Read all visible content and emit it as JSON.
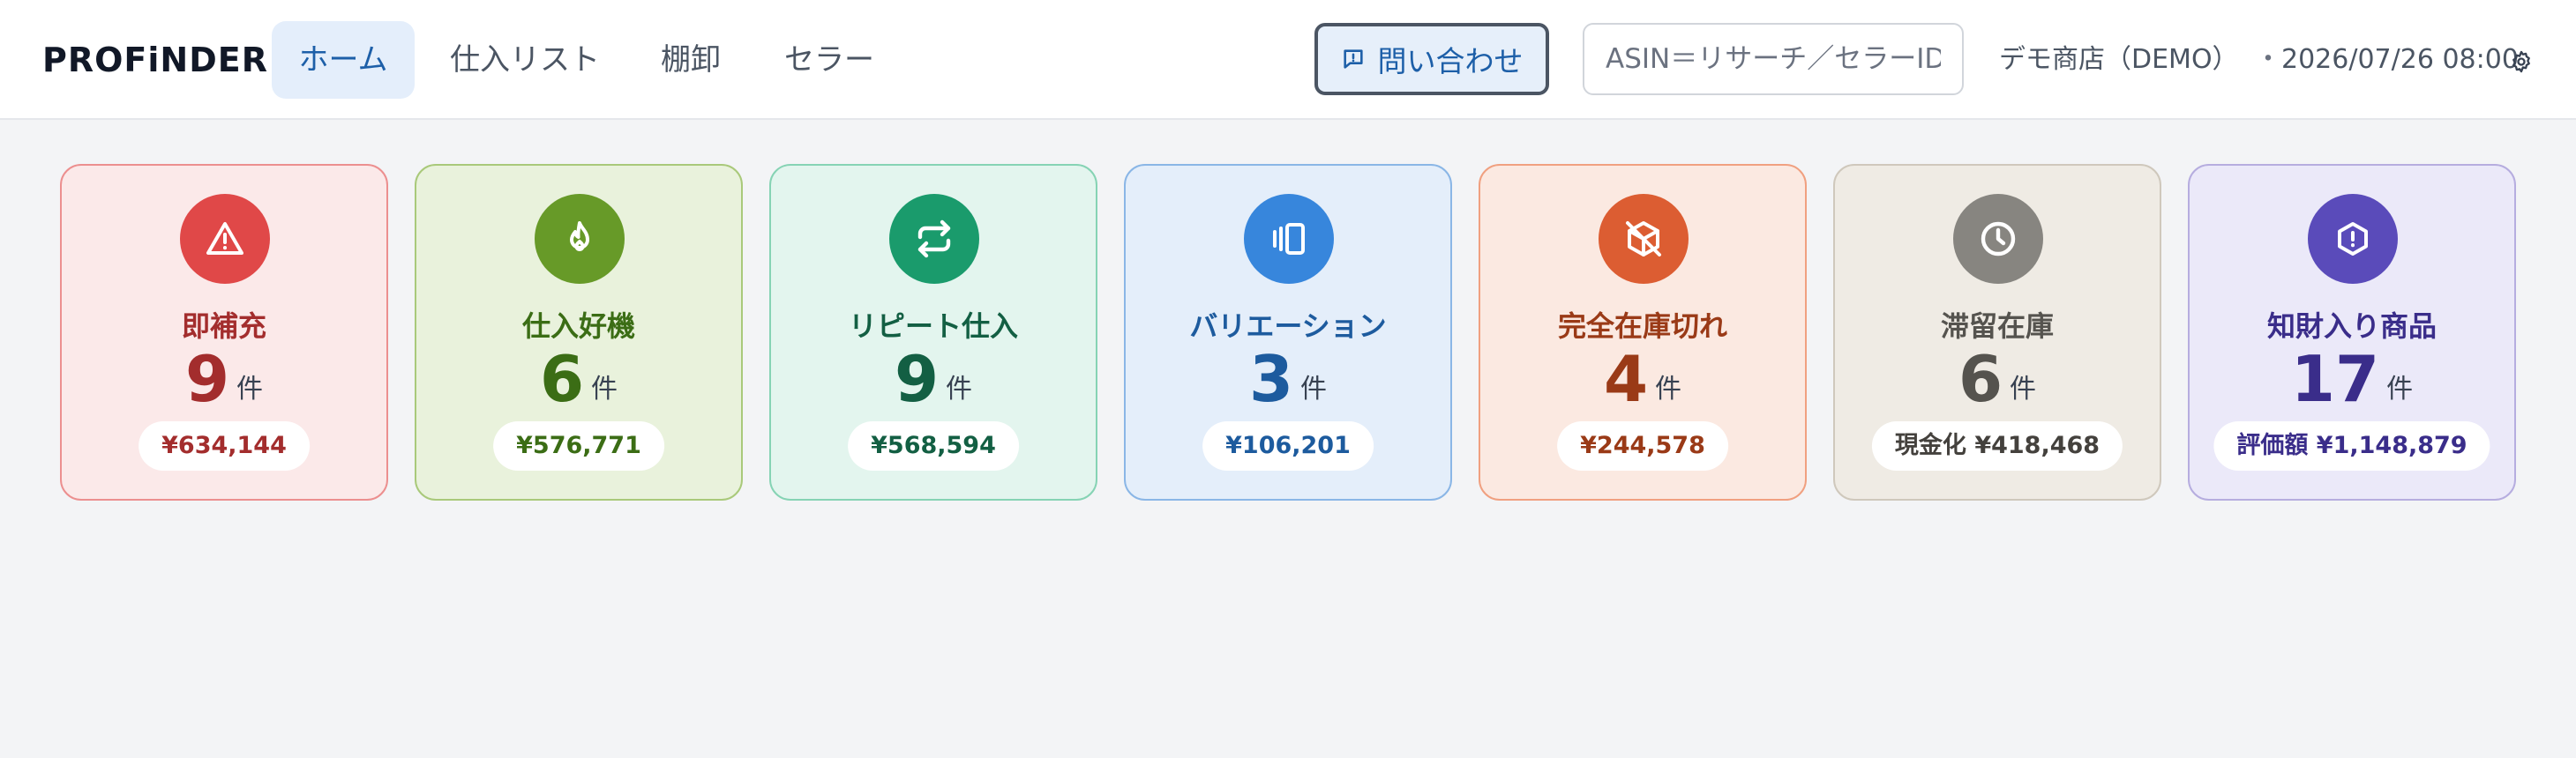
{
  "colors": {
    "replenish": {
      "icon_bg": "#e04848",
      "title": "#a32d2d",
      "num": "#a32d2d",
      "pill": "#a32d2d"
    },
    "deal": {
      "icon_bg": "#679a28",
      "title": "#3b6d15",
      "num": "#3b6d15",
      "pill": "#3b6d15"
    },
    "repeat": {
      "icon_bg": "#1a9b6c",
      "title": "#135f43",
      "num": "#135f43",
      "pill": "#135f43"
    },
    "variation": {
      "icon_bg": "#3786dc",
      "title": "#1d5b9e",
      "num": "#1d5b9e",
      "pill": "#1d5b9e"
    },
    "stockout": {
      "icon_bg": "#dc5d32",
      "title": "#9a3a17",
      "num": "#9a3a17",
      "pill": "#9a3a17"
    },
    "stagnant": {
      "icon_bg": "#878580",
      "title": "#55534e",
      "num": "#55534e",
      "pill": "#44413d"
    },
    "ip": {
      "icon_bg": "#5a4bba",
      "title": "#3a2d8a",
      "num": "#3a2d8a",
      "pill": "#3a2d8a"
    }
  },
  "header": {
    "logo": "PROFiNDER",
    "tabs": [
      {
        "label": "ホーム",
        "active": true
      },
      {
        "label": "仕入リスト",
        "active": false
      },
      {
        "label": "棚卸",
        "active": false
      },
      {
        "label": "セラー",
        "active": false
      }
    ],
    "contact_label": "問い合わせ",
    "contact_icon": "chat-alert-icon",
    "search_placeholder": "ASIN＝リサーチ／セラーID",
    "shop_name": "デモ商店（DEMO）",
    "separator": "・",
    "datetime": "2026/07/26 08:00",
    "settings_icon": "gear-icon"
  },
  "cards": [
    {
      "key": "replenish",
      "icon": "warning-icon",
      "title": "即補充",
      "count": "9",
      "unit": "件",
      "pill": "¥634,144"
    },
    {
      "key": "deal",
      "icon": "flame-icon",
      "title": "仕入好機",
      "count": "6",
      "unit": "件",
      "pill": "¥576,771"
    },
    {
      "key": "repeat",
      "icon": "repeat-icon",
      "title": "リピート仕入",
      "count": "9",
      "unit": "件",
      "pill": "¥568,594"
    },
    {
      "key": "variation",
      "icon": "variations-icon",
      "title": "バリエーション",
      "count": "3",
      "unit": "件",
      "pill": "¥106,201"
    },
    {
      "key": "stockout",
      "icon": "package-off-icon",
      "title": "完全在庫切れ",
      "count": "4",
      "unit": "件",
      "pill": "¥244,578"
    },
    {
      "key": "stagnant",
      "icon": "clock-icon",
      "title": "滞留在庫",
      "count": "6",
      "unit": "件",
      "pill": "現金化 ¥418,468"
    },
    {
      "key": "ip",
      "icon": "alert-octagon-icon",
      "title": "知財入り商品",
      "count": "17",
      "unit": "件",
      "pill": "評価額 ¥1,148,879"
    }
  ]
}
